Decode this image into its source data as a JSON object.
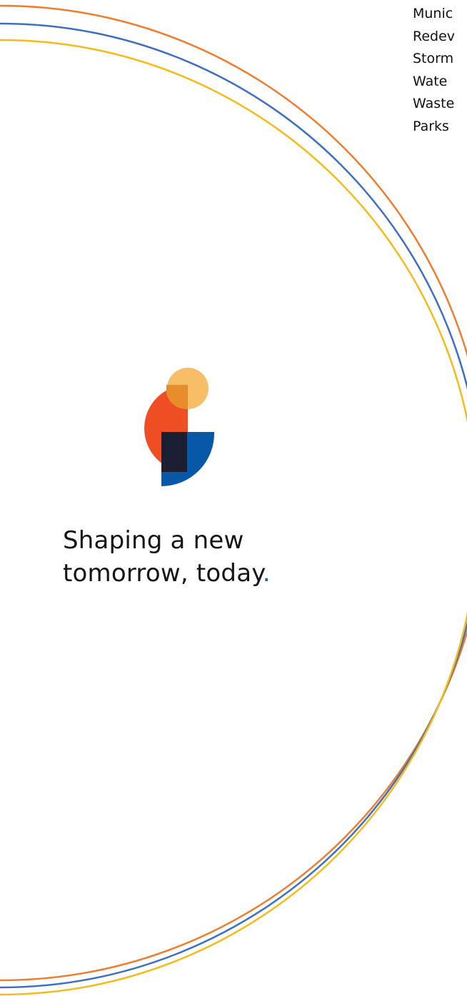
{
  "services": [
    "Munic",
    "Redev",
    "Storm",
    "Wate",
    "Waste",
    "Parks"
  ],
  "tagline": {
    "line1": "Shaping a new",
    "line2": "tomorrow, today",
    "punctuation": "."
  },
  "colors": {
    "orange": "#ef7d2e",
    "blue": "#3e6fc1",
    "yellow": "#f4bb1a",
    "logo_red": "#ef4e24",
    "logo_gold": "#f6b656",
    "logo_navy": "#1a1f33",
    "logo_blue": "#0758a8",
    "accent_dot": "#1f5fae"
  }
}
